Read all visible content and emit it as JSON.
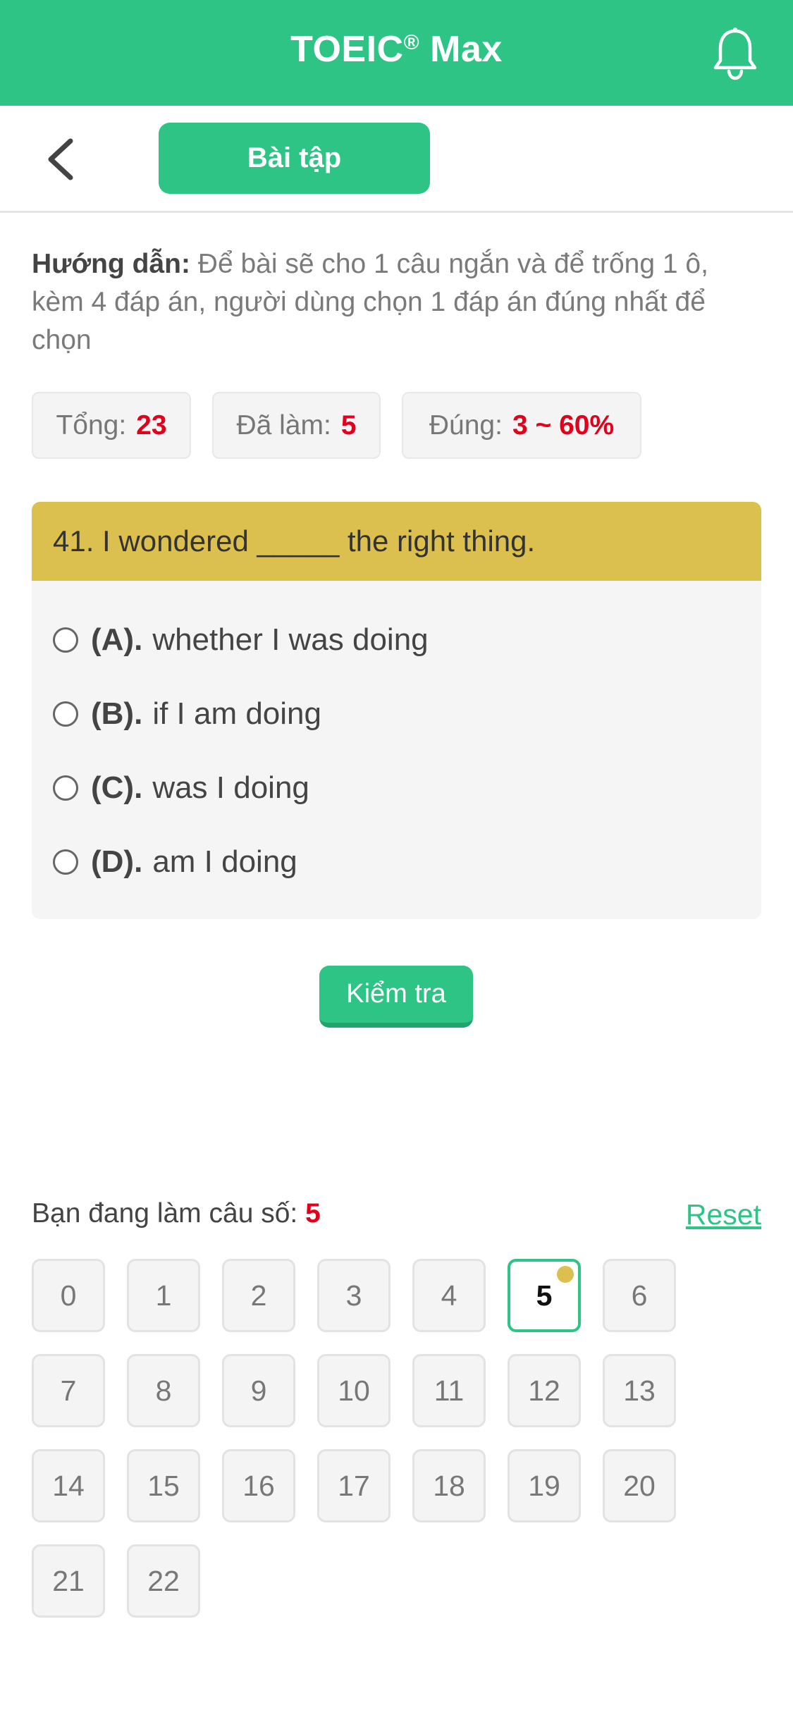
{
  "app": {
    "title": "TOEIC",
    "title_mark": "®",
    "title_suffix": " Max"
  },
  "icons": {
    "bell": "bell-icon",
    "back": "chevron-left-icon"
  },
  "colors": {
    "brand": "#2ec486",
    "question_header": "#dcc04f",
    "highlight": "#e3001b"
  },
  "toolbar": {
    "tab_label": "Bài tập"
  },
  "guide": {
    "label": "Hướng dẫn:",
    "text": " Để bài sẽ cho 1 câu ngắn và để trống 1 ô, kèm 4 đáp án, người dùng chọn 1 đáp án đúng nhất để chọn"
  },
  "stats": {
    "total_label": "Tổng:",
    "total_value": "23",
    "done_label": "Đã làm:",
    "done_value": "5",
    "correct_label": "Đúng:",
    "correct_value": "3 ~ 60%"
  },
  "question": {
    "text": "41. I wondered _____ the right thing.",
    "options": [
      {
        "label": "(A).",
        "text": "whether I was doing"
      },
      {
        "label": "(B).",
        "text": "if I am doing"
      },
      {
        "label": "(C).",
        "text": "was I doing"
      },
      {
        "label": "(D).",
        "text": "am I doing"
      }
    ]
  },
  "check_button": "Kiểm tra",
  "progress": {
    "label": "Bạn đang làm câu số:",
    "current": "5",
    "reset_label": "Reset"
  },
  "question_numbers": [
    "0",
    "1",
    "2",
    "3",
    "4",
    "5",
    "6",
    "7",
    "8",
    "9",
    "10",
    "11",
    "12",
    "13",
    "14",
    "15",
    "16",
    "17",
    "18",
    "19",
    "20",
    "21",
    "22"
  ],
  "active_question": "5"
}
